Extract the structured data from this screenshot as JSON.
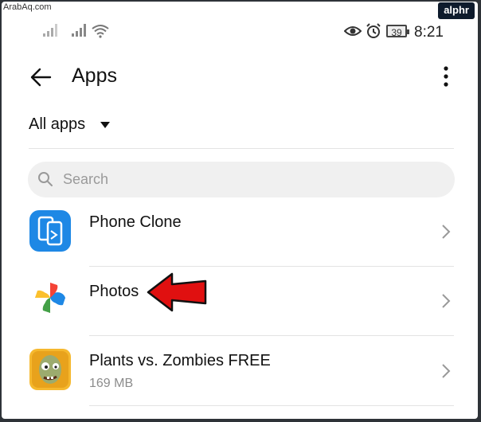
{
  "watermark": "ArabAq.com",
  "brand": "alphr",
  "status_bar": {
    "time": "8:21",
    "battery": "39",
    "icons": [
      "signal-icon",
      "signal-icon",
      "wifi-icon",
      "eye-icon",
      "alarm-icon",
      "battery-icon"
    ]
  },
  "header": {
    "title": "Apps",
    "back_icon": "back-arrow-icon",
    "menu_icon": "more-vert-icon"
  },
  "filter": {
    "label": "All apps"
  },
  "search": {
    "placeholder": "Search"
  },
  "apps": [
    {
      "name": "Phone Clone",
      "size": "",
      "icon": "phone-clone-icon",
      "icon_color": "#1e88e5"
    },
    {
      "name": "Photos",
      "size": "",
      "icon": "google-photos-icon"
    },
    {
      "name": "Plants vs. Zombies FREE",
      "size": "169 MB",
      "icon": "plants-vs-zombies-icon"
    }
  ],
  "annotation": {
    "icon": "red-arrow-pointer-icon",
    "color": "#e01010"
  }
}
